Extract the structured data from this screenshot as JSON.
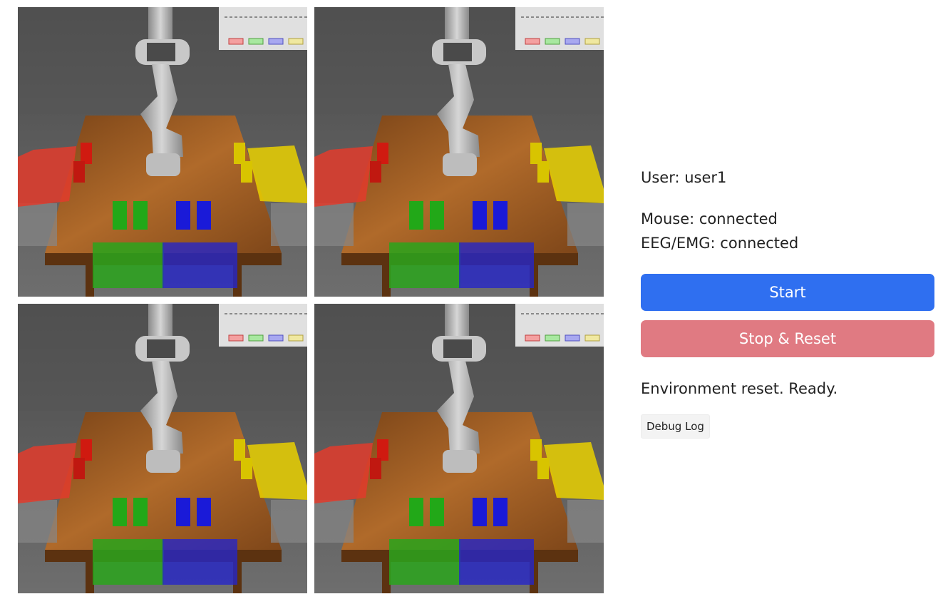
{
  "session": {
    "user_label": "User: user1",
    "mouse_label": "Mouse: connected",
    "eeg_label": "EEG/EMG: connected"
  },
  "controls": {
    "start_label": "Start",
    "stop_reset_label": "Stop & Reset"
  },
  "status_text": "Environment reset. Ready.",
  "debug_log_label": "Debug Log",
  "colors": {
    "start_button": "#2f6ff0",
    "stop_button": "#e07a82",
    "bin_red": "#e23b2b",
    "bin_yellow": "#e9d000",
    "bin_green": "#2aa51c",
    "bin_blue": "#2626c8",
    "table_wood": "#9a5a22"
  },
  "camera_views": [
    {
      "id": "view-1"
    },
    {
      "id": "view-2"
    },
    {
      "id": "view-3"
    },
    {
      "id": "view-4"
    }
  ]
}
